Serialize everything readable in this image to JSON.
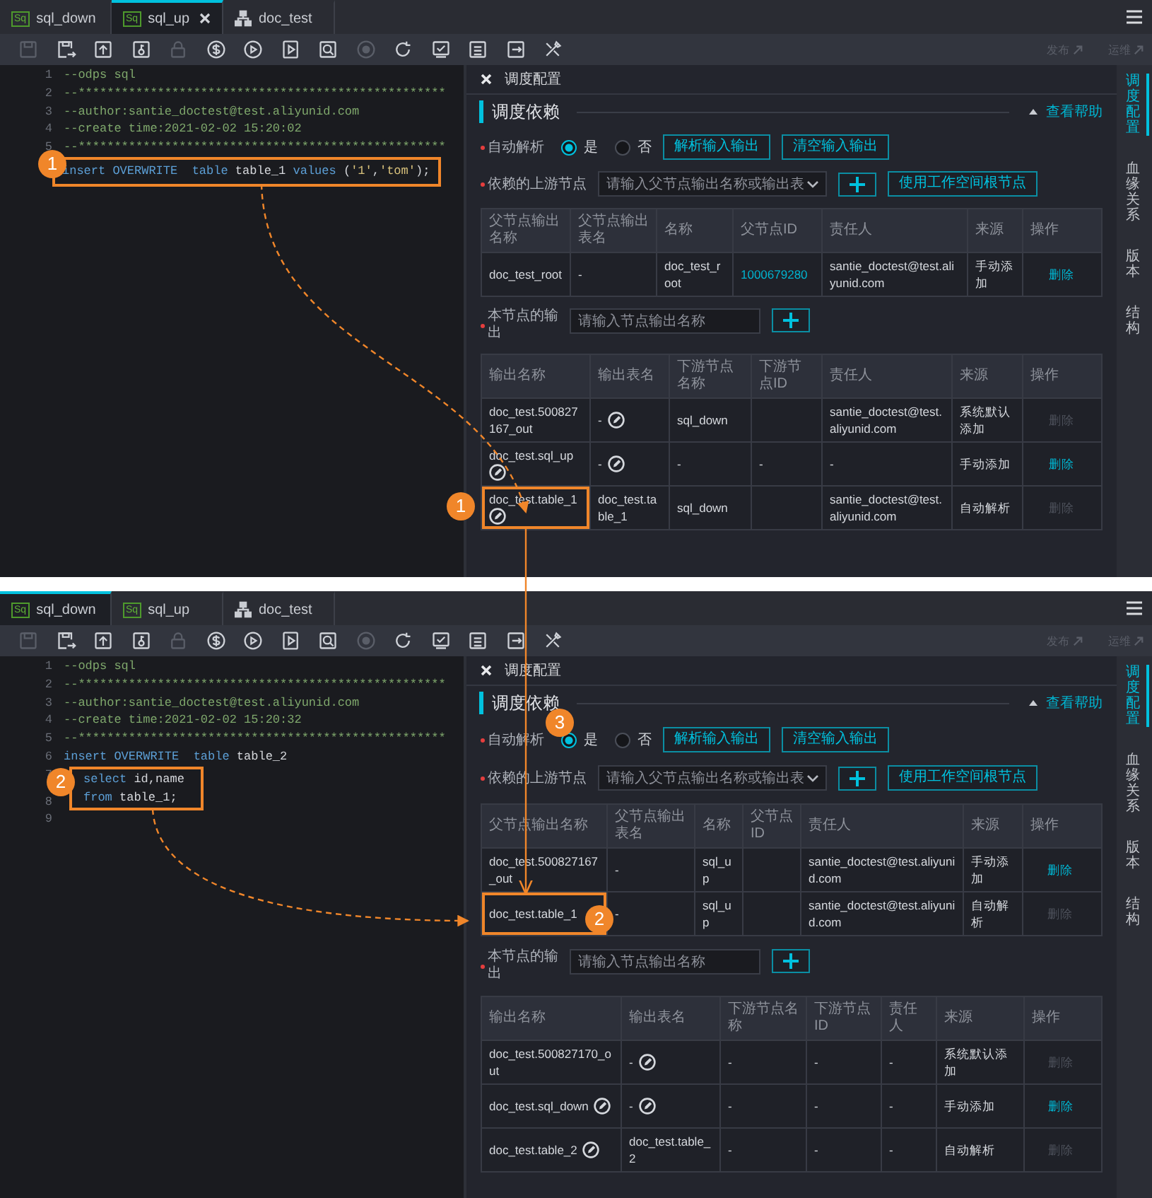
{
  "screens": [
    {
      "tabs": [
        {
          "label": "sql_down",
          "kind": "sql",
          "icon_text": "Sq",
          "selected": false
        },
        {
          "label": "sql_up",
          "kind": "sql",
          "icon_text": "Sq",
          "selected": true
        },
        {
          "label": "doc_test",
          "kind": "flow",
          "selected": false
        }
      ],
      "toolbar": {
        "tools": [
          {
            "kind": "save",
            "disabled": true
          },
          {
            "kind": "save-as",
            "disabled": false
          },
          {
            "kind": "upload",
            "disabled": false
          },
          {
            "kind": "key-doc",
            "disabled": false
          },
          {
            "kind": "lock",
            "disabled": true
          },
          {
            "kind": "coin",
            "disabled": false
          },
          {
            "kind": "run",
            "disabled": false
          },
          {
            "kind": "run-doc",
            "disabled": false
          },
          {
            "kind": "inspect",
            "disabled": false
          },
          {
            "kind": "stop",
            "disabled": true
          },
          {
            "kind": "reload",
            "disabled": false
          },
          {
            "kind": "check",
            "disabled": false
          },
          {
            "kind": "list",
            "disabled": false
          },
          {
            "kind": "export",
            "disabled": false
          },
          {
            "kind": "tools",
            "disabled": false
          }
        ],
        "actions": [
          {
            "label": "发布",
            "disabled": true
          },
          {
            "label": "运维",
            "disabled": true
          }
        ]
      },
      "editor": {
        "lines": [
          {
            "number": "1",
            "highlighted": false,
            "tokens": [
              {
                "text": "--odps sql",
                "kind": "comment"
              }
            ]
          },
          {
            "number": "2",
            "highlighted": false,
            "tokens": [
              {
                "text": "--***************************************************",
                "kind": "comment"
              }
            ]
          },
          {
            "number": "3",
            "highlighted": false,
            "tokens": [
              {
                "text": "--author:santie_doctest@test.aliyunid.com",
                "kind": "comment"
              }
            ]
          },
          {
            "number": "4",
            "highlighted": false,
            "tokens": [
              {
                "text": "--create time:2021-02-02 15:20:02",
                "kind": "comment"
              }
            ]
          },
          {
            "number": "5",
            "highlighted": false,
            "tokens": [
              {
                "text": "--***************************************************",
                "kind": "comment"
              }
            ]
          },
          {
            "highlighted": true,
            "tokens": [
              {
                "text": "insert OVERWRITE  table",
                "kind": "keyword"
              },
              {
                "text": " table_1 ",
                "kind": "plain"
              },
              {
                "text": "values",
                "kind": "keyword"
              },
              {
                "text": " (",
                "kind": "plain"
              },
              {
                "text": "'1'",
                "kind": "string"
              },
              {
                "text": ",",
                "kind": "plain"
              },
              {
                "text": "'tom'",
                "kind": "string"
              },
              {
                "text": ");",
                "kind": "plain"
              }
            ]
          }
        ]
      },
      "panel": {
        "title": "调度配置",
        "section": "调度依赖",
        "help_link": "查看帮助",
        "auto_parse": {
          "label": "自动解析",
          "required": true,
          "options": [
            {
              "label": "是",
              "selected": true
            },
            {
              "label": "否",
              "selected": false
            }
          ],
          "buttons": [
            "解析输入输出",
            "清空输入输出"
          ]
        },
        "upstream": {
          "label": "依赖的上游节点",
          "required": true,
          "placeholder": "请输入父节点输出名称或输出表",
          "root_button": "使用工作空间根节点"
        },
        "parent_table": {
          "columns": [
            "父节点输出名称",
            "父节点输出表名",
            "名称",
            "父节点ID",
            "责任人",
            "来源",
            "操作"
          ],
          "rows": [
            {
              "highlighted": false,
              "cells": [
                {
                  "text": "doc_test_root"
                },
                {
                  "text": "-"
                },
                {
                  "text": "doc_test_root"
                },
                {
                  "text": "1000679280",
                  "link": true
                },
                {
                  "text": "santie_doctest@test.aliyunid.com"
                },
                {
                  "text": "手动添加"
                }
              ],
              "action": {
                "label": "删除",
                "disabled": false
              }
            }
          ]
        },
        "output": {
          "label": "本节点的输出",
          "required": true,
          "placeholder": "请输入节点输出名称"
        },
        "output_table": {
          "columns": [
            "输出名称",
            "输出表名",
            "下游节点名称",
            "下游节点ID",
            "责任人",
            "来源",
            "操作"
          ],
          "rows": [
            {
              "highlighted": false,
              "cells": [
                {
                  "text": "doc_test.500827167_out",
                  "editable": false
                },
                {
                  "text": "-",
                  "editable": true
                },
                {
                  "text": "sql_down"
                },
                {},
                {
                  "text": "santie_doctest@test.aliyunid.com"
                },
                {
                  "text": "系统默认添加"
                }
              ],
              "action": {
                "label": "删除",
                "disabled": true
              }
            },
            {
              "highlighted": false,
              "cells": [
                {
                  "text": "doc_test.sql_up",
                  "editable": true
                },
                {
                  "text": "-",
                  "editable": true
                },
                {
                  "text": "-"
                },
                {
                  "text": "-"
                },
                {
                  "text": "-"
                },
                {
                  "text": "手动添加"
                }
              ],
              "action": {
                "label": "删除",
                "disabled": false
              }
            },
            {
              "highlighted": true,
              "cells": [
                {
                  "text": "doc_test.table_1",
                  "editable": true
                },
                {
                  "text": "doc_test.table_1",
                  "editable": false
                },
                {
                  "text": "sql_down"
                },
                {},
                {
                  "text": "santie_doctest@test.aliyunid.com"
                },
                {
                  "text": "自动解析"
                }
              ],
              "action": {
                "label": "删除",
                "disabled": true
              }
            }
          ]
        }
      },
      "sidebar": {
        "items": [
          {
            "label": "调度配置",
            "selected": true
          },
          {
            "label": "血缘关系",
            "selected": false
          },
          {
            "label": "版本",
            "selected": false
          },
          {
            "label": "结构",
            "selected": false
          }
        ]
      }
    },
    {
      "tabs": [
        {
          "label": "sql_down",
          "kind": "sql",
          "icon_text": "Sq",
          "selected": true
        },
        {
          "label": "sql_up",
          "kind": "sql",
          "icon_text": "Sq",
          "selected": false
        },
        {
          "label": "doc_test",
          "kind": "flow",
          "selected": false
        }
      ],
      "toolbar": {
        "tools": [
          {
            "kind": "save",
            "disabled": true
          },
          {
            "kind": "save-as",
            "disabled": false
          },
          {
            "kind": "upload",
            "disabled": false
          },
          {
            "kind": "key-doc",
            "disabled": false
          },
          {
            "kind": "lock",
            "disabled": true
          },
          {
            "kind": "coin",
            "disabled": false
          },
          {
            "kind": "run",
            "disabled": false
          },
          {
            "kind": "run-doc",
            "disabled": false
          },
          {
            "kind": "inspect",
            "disabled": false
          },
          {
            "kind": "stop",
            "disabled": true
          },
          {
            "kind": "reload",
            "disabled": false
          },
          {
            "kind": "check",
            "disabled": false
          },
          {
            "kind": "list",
            "disabled": false
          },
          {
            "kind": "export",
            "disabled": false
          },
          {
            "kind": "tools",
            "disabled": false
          }
        ],
        "actions": [
          {
            "label": "发布",
            "disabled": true
          },
          {
            "label": "运维",
            "disabled": true
          }
        ]
      },
      "editor": {
        "lines": [
          {
            "number": "1",
            "highlighted": false,
            "tokens": [
              {
                "text": "--odps sql",
                "kind": "comment"
              }
            ]
          },
          {
            "number": "2",
            "highlighted": false,
            "tokens": [
              {
                "text": "--***************************************************",
                "kind": "comment"
              }
            ]
          },
          {
            "number": "3",
            "highlighted": false,
            "tokens": [
              {
                "text": "--author:santie_doctest@test.aliyunid.com",
                "kind": "comment"
              }
            ]
          },
          {
            "number": "4",
            "highlighted": false,
            "tokens": [
              {
                "text": "--create time:2021-02-02 15:20:32",
                "kind": "comment"
              }
            ]
          },
          {
            "number": "5",
            "highlighted": false,
            "tokens": [
              {
                "text": "--***************************************************",
                "kind": "comment"
              }
            ]
          },
          {
            "number": "6",
            "highlighted": false,
            "tokens": [
              {
                "text": "insert OVERWRITE  table",
                "kind": "keyword"
              },
              {
                "text": " table_2",
                "kind": "plain"
              }
            ]
          },
          {
            "number": "7",
            "highlighted": true,
            "tokens": [
              {
                "text": "select",
                "kind": "keyword"
              },
              {
                "text": " id,name",
                "kind": "plain"
              }
            ]
          },
          {
            "number": "8",
            "highlighted": true,
            "tokens": [
              {
                "text": "from",
                "kind": "keyword"
              },
              {
                "text": " table_1;",
                "kind": "plain"
              }
            ]
          },
          {
            "number": "9"
          }
        ]
      },
      "panel": {
        "title": "调度配置",
        "section": "调度依赖",
        "help_link": "查看帮助",
        "auto_parse": {
          "label": "自动解析",
          "required": true,
          "options": [
            {
              "label": "是",
              "selected": true
            },
            {
              "label": "否",
              "selected": false
            }
          ],
          "buttons": [
            "解析输入输出",
            "清空输入输出"
          ]
        },
        "upstream": {
          "label": "依赖的上游节点",
          "required": true,
          "placeholder": "请输入父节点输出名称或输出表",
          "root_button": "使用工作空间根节点"
        },
        "parent_table": {
          "columns": [
            "父节点输出名称",
            "父节点输出表名",
            "名称",
            "父节点ID",
            "责任人",
            "来源",
            "操作"
          ],
          "rows": [
            {
              "highlighted": false,
              "cells": [
                {
                  "text": "doc_test.500827167_out"
                },
                {
                  "text": "-"
                },
                {
                  "text": "sql_up"
                },
                {},
                {
                  "text": "santie_doctest@test.aliyunid.com"
                },
                {
                  "text": "手动添加"
                }
              ],
              "action": {
                "label": "删除",
                "disabled": false
              }
            },
            {
              "highlighted": true,
              "cells": [
                {
                  "text": "doc_test.table_1"
                },
                {
                  "text": "-"
                },
                {
                  "text": "sql_up"
                },
                {},
                {
                  "text": "santie_doctest@test.aliyunid.com"
                },
                {
                  "text": "自动解析"
                }
              ],
              "action": {
                "label": "删除",
                "disabled": true
              }
            }
          ]
        },
        "output": {
          "label": "本节点的输出",
          "required": true,
          "placeholder": "请输入节点输出名称"
        },
        "output_table": {
          "columns": [
            "输出名称",
            "输出表名",
            "下游节点名称",
            "下游节点ID",
            "责任人",
            "来源",
            "操作"
          ],
          "rows": [
            {
              "highlighted": false,
              "cells": [
                {
                  "text": "doc_test.500827170_out",
                  "editable": false
                },
                {
                  "text": "-",
                  "editable": true
                },
                {
                  "text": "-"
                },
                {
                  "text": "-"
                },
                {
                  "text": "-"
                },
                {
                  "text": "系统默认添加"
                }
              ],
              "action": {
                "label": "删除",
                "disabled": true
              }
            },
            {
              "highlighted": false,
              "cells": [
                {
                  "text": "doc_test.sql_down",
                  "editable": true
                },
                {
                  "text": "-",
                  "editable": true
                },
                {
                  "text": "-"
                },
                {
                  "text": "-"
                },
                {
                  "text": "-"
                },
                {
                  "text": "手动添加"
                }
              ],
              "action": {
                "label": "删除",
                "disabled": false
              }
            },
            {
              "highlighted": false,
              "cells": [
                {
                  "text": "doc_test.table_2",
                  "editable": true
                },
                {
                  "text": "doc_test.table_2",
                  "editable": false
                },
                {
                  "text": "-"
                },
                {
                  "text": "-"
                },
                {
                  "text": "-"
                },
                {
                  "text": "自动解析"
                }
              ],
              "action": {
                "label": "删除",
                "disabled": true
              }
            }
          ]
        }
      },
      "sidebar": {
        "items": [
          {
            "label": "调度配置",
            "selected": true
          },
          {
            "label": "血缘关系",
            "selected": false
          },
          {
            "label": "版本",
            "selected": false
          },
          {
            "label": "结构",
            "selected": false
          }
        ]
      }
    }
  ],
  "callouts": [
    {
      "label": "1"
    },
    {
      "label": "1"
    },
    {
      "label": "3"
    },
    {
      "label": "2"
    },
    {
      "label": "2"
    }
  ]
}
